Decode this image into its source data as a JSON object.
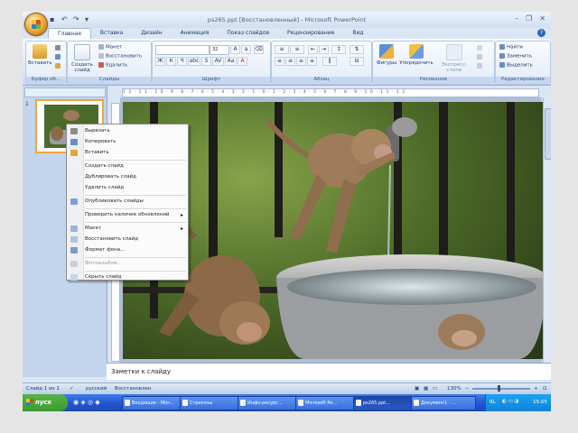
{
  "app": {
    "window_title": "ps265.ppt [Восстановленный] - Microsoft PowerPoint",
    "window_controls": [
      "–",
      "❐",
      "✕"
    ],
    "help": "?"
  },
  "ribbon": {
    "tabs": [
      "Главная",
      "Вставка",
      "Дизайн",
      "Анимация",
      "Показ слайдов",
      "Рецензирование",
      "Вид"
    ],
    "groups": [
      {
        "label": "Буфер об...",
        "buttons": [
          "Вставить"
        ],
        "small": []
      },
      {
        "label": "Слайды",
        "buttons": [
          "Создать слайд"
        ],
        "small": [
          "Макет",
          "Восстановить",
          "Удалить"
        ]
      },
      {
        "label": "Шрифт",
        "font_name": "",
        "font_size": "32"
      },
      {
        "label": "Абзац"
      },
      {
        "label": "Рисование",
        "buttons": [
          "Фигуры",
          "Упорядочить",
          "Экспресс-стили"
        ]
      },
      {
        "label": "Редактирование",
        "small": [
          "Найти",
          "Заменить",
          "Выделить"
        ]
      }
    ],
    "font_tools": [
      "Ж",
      "К",
      "Ч",
      "abc",
      "S",
      "AV",
      "Aa",
      "A"
    ]
  },
  "slides_pane": {
    "slide_number": "1"
  },
  "ruler": {
    "marks": "12·11·10·9·8·7·6·5·4·3·2·1·0·1·2·3·4·5·6·7·8·9·10·11·12"
  },
  "context_menu": {
    "items": [
      {
        "label": "Вырезать",
        "disabled": false,
        "icon_color": "#8c8c8c",
        "submenu": false
      },
      {
        "label": "Копировать",
        "disabled": false,
        "icon_color": "#6b8cc4",
        "submenu": false
      },
      {
        "label": "Вставить",
        "disabled": false,
        "icon_color": "#e0a63a",
        "submenu": false
      },
      {
        "label": "Создать слайд",
        "disabled": false,
        "icon_color": "#f2f2f2",
        "submenu": false
      },
      {
        "label": "Дублировать слайд",
        "disabled": false,
        "icon_color": "",
        "submenu": false
      },
      {
        "label": "Удалить слайд",
        "disabled": false,
        "icon_color": "",
        "submenu": false
      },
      {
        "label": "Опубликовать слайды",
        "disabled": false,
        "icon_color": "#7aa0d8",
        "submenu": false
      },
      {
        "label": "Проверить наличие обновлений",
        "disabled": false,
        "icon_color": "",
        "submenu": true
      },
      {
        "label": "Макет",
        "disabled": false,
        "icon_color": "#9bb4d8",
        "submenu": true
      },
      {
        "label": "Восстановить слайд",
        "disabled": false,
        "icon_color": "#b2c2d8",
        "submenu": false
      },
      {
        "label": "Формат фона...",
        "disabled": false,
        "icon_color": "#7a9ccc",
        "submenu": false
      },
      {
        "label": "Фотоальбом...",
        "disabled": true,
        "icon_color": "#cfcfcf",
        "submenu": false
      },
      {
        "label": "Скрыть слайд",
        "disabled": false,
        "icon_color": "#c9d4e6",
        "submenu": false
      }
    ]
  },
  "notes": {
    "placeholder": "Заметки к слайду"
  },
  "status": {
    "slide": "Слайд 1 из 1",
    "language": "русский",
    "recovered": "Восстановлен",
    "zoom": "130%"
  },
  "taskbar": {
    "start": "пуск",
    "buttons": [
      "Входящие - Micr...",
      "Стрекозы",
      "Инфо-ресурс...",
      "Microsoft Po...",
      "ps265.ppt...",
      "Документ1 - ..."
    ],
    "active_index": 4,
    "tray_lang": "RL",
    "clock": "15:05"
  }
}
